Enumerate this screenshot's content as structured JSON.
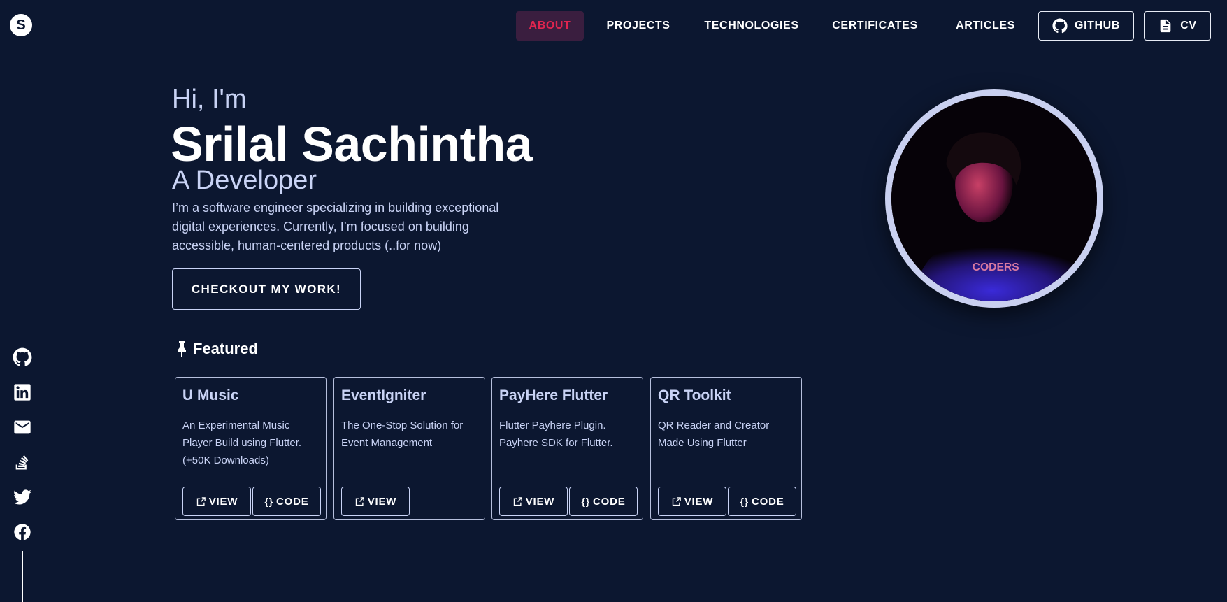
{
  "logo": {
    "letter": "S"
  },
  "nav": {
    "items": [
      {
        "label": "ABOUT",
        "active": true
      },
      {
        "label": "PROJECTS",
        "active": false
      },
      {
        "label": "TECHNOLOGIES",
        "active": false
      },
      {
        "label": "CERTIFICATES",
        "active": false
      },
      {
        "label": "ARTICLES",
        "active": false
      }
    ],
    "github_label": "GITHUB",
    "cv_label": "CV"
  },
  "hero": {
    "greeting": "Hi, I'm",
    "name": "Srilal Sachintha",
    "role": "A Developer",
    "description": "I’m a software engineer specializing in building exceptional digital experiences. Currently, I’m focused on building accessible, human-centered products (..for now)",
    "cta_label": "CHECKOUT MY WORK!"
  },
  "avatar": {
    "shirt_text": "CODERS"
  },
  "featured": {
    "title": "Featured",
    "cards": [
      {
        "title": "U Music",
        "description": "An Experimental Music Player Build using Flutter. (+50K Downloads)",
        "view_label": "VIEW",
        "code_label": "CODE"
      },
      {
        "title": "EventIgniter",
        "description": "The One-Stop Solution for Event Management",
        "view_label": "VIEW"
      },
      {
        "title": "PayHere Flutter",
        "description": "Flutter Payhere Plugin. Payhere SDK for Flutter.",
        "view_label": "VIEW",
        "code_label": "CODE"
      },
      {
        "title": "QR Toolkit",
        "description": "QR Reader and Creator Made Using Flutter",
        "view_label": "VIEW",
        "code_label": "CODE"
      }
    ],
    "code_icon": "{}"
  },
  "colors": {
    "background": "#0c1730",
    "accent": "#e0254f",
    "muted_text": "#c9d3f5"
  },
  "social_icons": [
    "github-icon",
    "linkedin-icon",
    "mail-icon",
    "stackoverflow-icon",
    "twitter-icon",
    "facebook-icon"
  ]
}
